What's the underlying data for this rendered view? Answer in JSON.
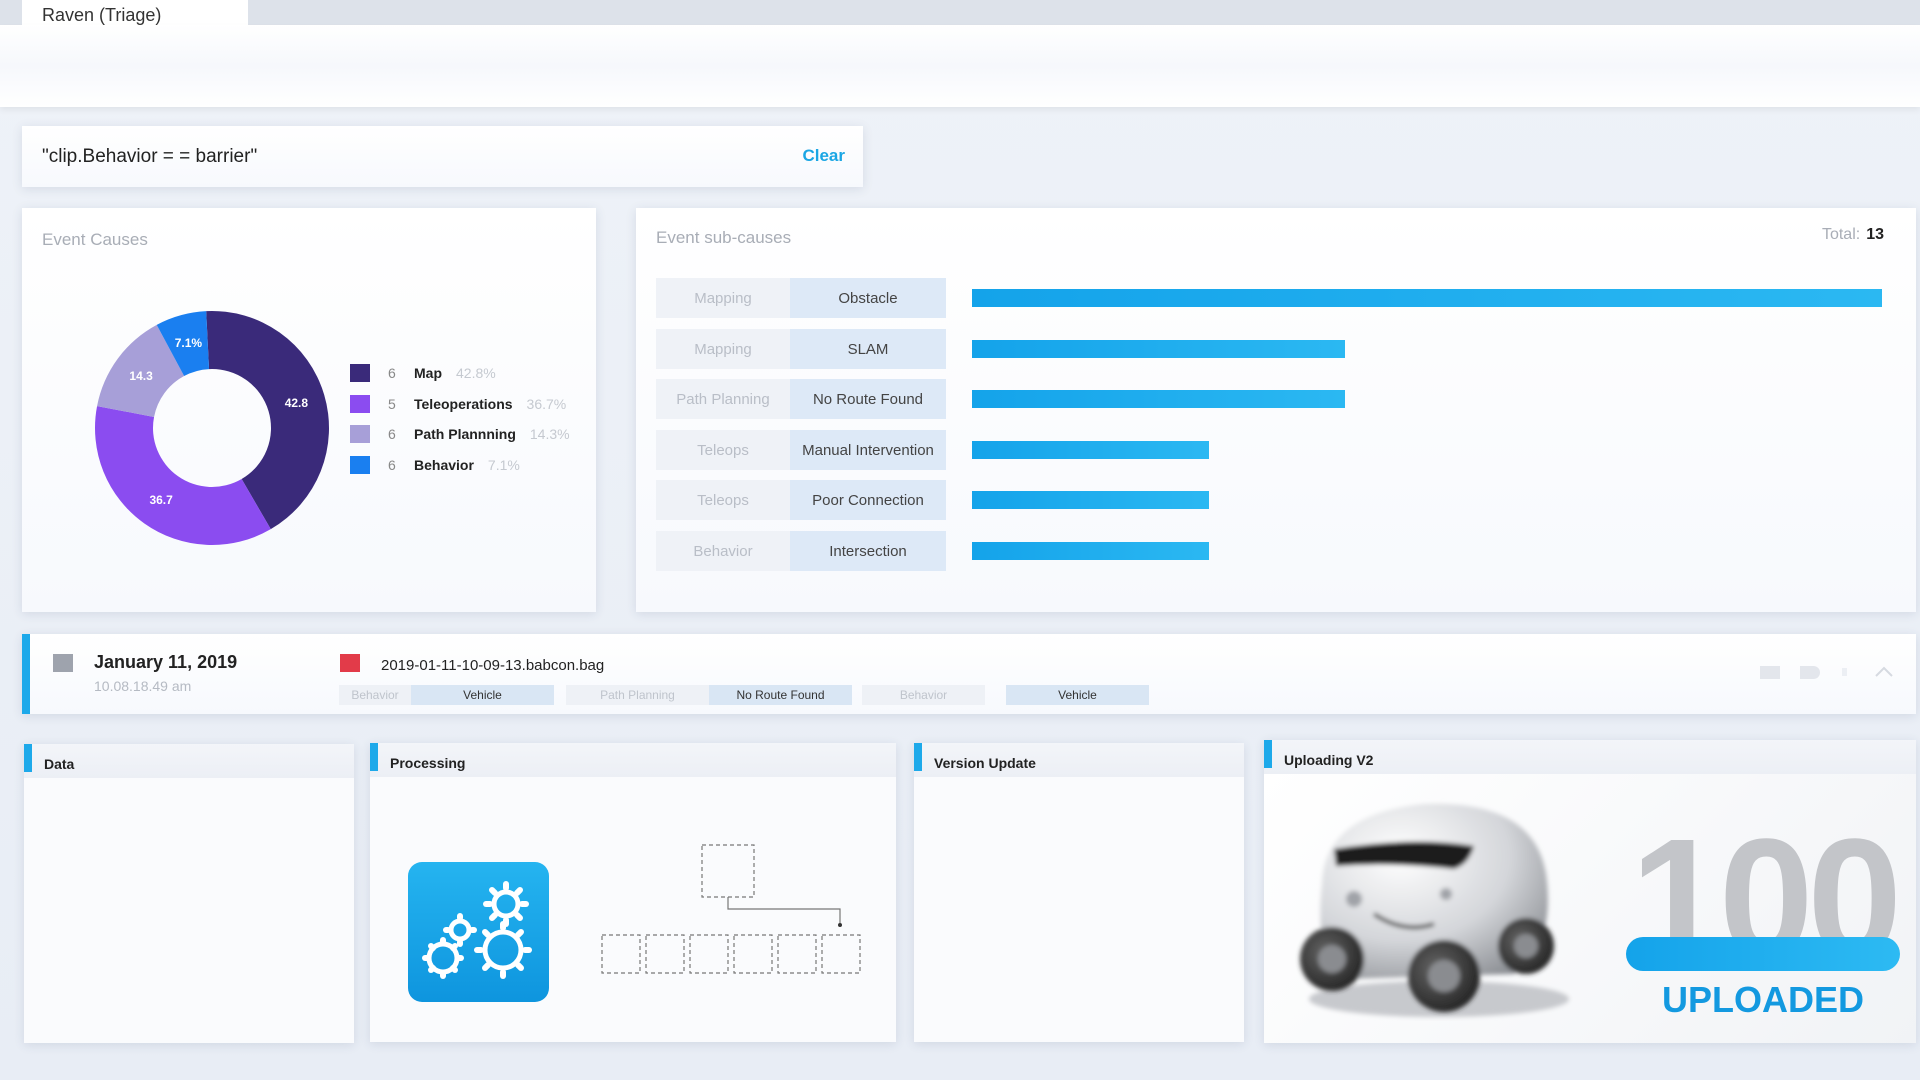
{
  "window": {
    "tab_title": "Raven (Triage)"
  },
  "search": {
    "query": "\"clip.Behavior = = barrier\"",
    "clear_label": "Clear"
  },
  "causes": {
    "title": "Event Causes",
    "legend": [
      {
        "count": "6",
        "name": "Map",
        "pct": "42.8%",
        "color": "#3a2a7a"
      },
      {
        "count": "5",
        "name": "Teleoperations",
        "pct": "36.7%",
        "color": "#8b4cf0"
      },
      {
        "count": "6",
        "name": "Path Plannning",
        "pct": "14.3%",
        "color": "#a79fd8"
      },
      {
        "count": "6",
        "name": "Behavior",
        "pct": "7.1%",
        "color": "#1a7ff0"
      }
    ],
    "slice_labels": [
      "42.8",
      "36.7",
      "14.3",
      "7.1%"
    ]
  },
  "chart_data": {
    "type": "pie",
    "categories": [
      "Map",
      "Teleoperations",
      "Path Plannning",
      "Behavior"
    ],
    "values": [
      42.8,
      36.7,
      14.3,
      7.1
    ],
    "colors": [
      "#3a2a7a",
      "#8b4cf0",
      "#a79fd8",
      "#1a7ff0"
    ],
    "title": "Event Causes"
  },
  "subcauses": {
    "title": "Event sub-causes",
    "total_label": "Total:",
    "total_value": "13",
    "rows": [
      {
        "category": "Mapping",
        "name": "Obstacle",
        "level": 1.0
      },
      {
        "category": "Mapping",
        "name": "SLAM",
        "level": 0.41
      },
      {
        "category": "Path Planning",
        "name": "No Route Found",
        "level": 0.41
      },
      {
        "category": "Teleops",
        "name": "Manual Intervention",
        "level": 0.26
      },
      {
        "category": "Teleops",
        "name": "Poor Connection",
        "level": 0.26
      },
      {
        "category": "Behavior",
        "name": "Intersection",
        "level": 0.26
      }
    ]
  },
  "event": {
    "date": "January 11, 2019",
    "time": "10.08.18.49 am",
    "bag": "2019-01-11-10-09-13.babcon.bag",
    "tags": [
      {
        "category": "Behavior",
        "value": "Vehicle"
      },
      {
        "category": "Path Planning",
        "value": "No Route Found"
      },
      {
        "category": "Behavior",
        "value": "Vehicle"
      }
    ]
  },
  "cards": {
    "data": "Data",
    "processing": "Processing",
    "version": "Version Update",
    "uploading": "Uploading V2",
    "upload_progress": "100",
    "upload_status": "UPLOADED"
  },
  "icons": [
    "gear-icon",
    "robot-vehicle-icon",
    "chevron-up-icon",
    "flag-icon",
    "tag-icon"
  ]
}
